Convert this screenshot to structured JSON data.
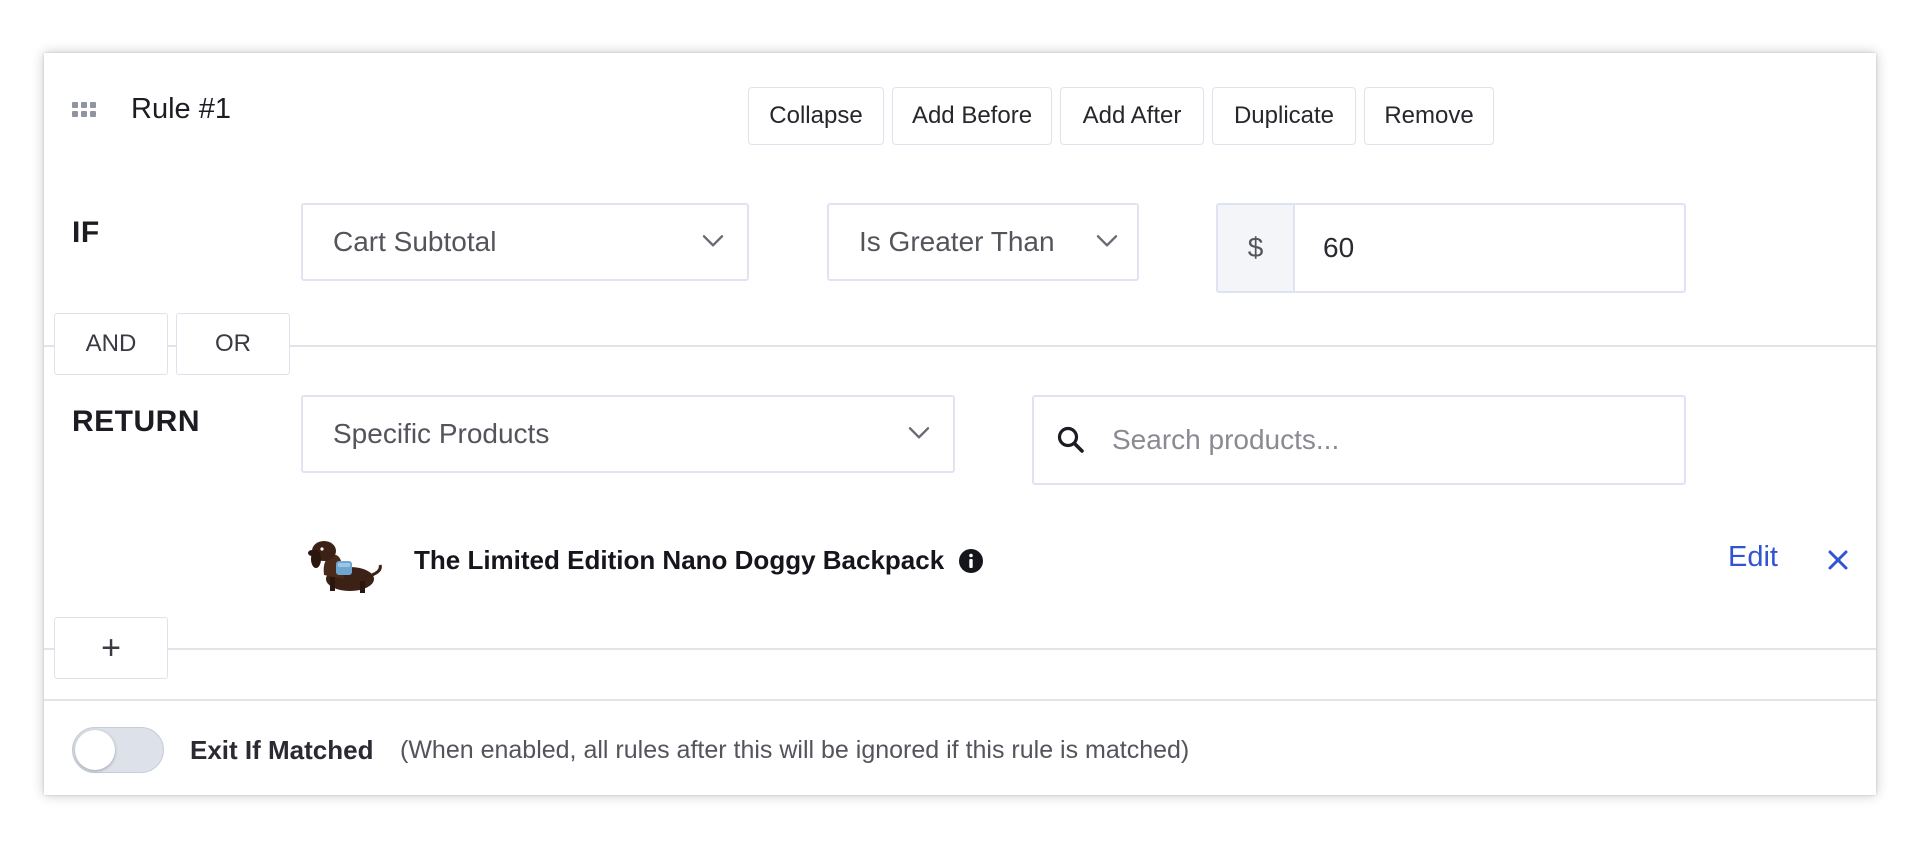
{
  "rule": {
    "title": "Rule #1"
  },
  "toolbar": {
    "collapse_label": "Collapse",
    "add_before_label": "Add Before",
    "add_after_label": "Add After",
    "duplicate_label": "Duplicate",
    "remove_label": "Remove"
  },
  "condition": {
    "label": "IF",
    "field_selected": "Cart Subtotal",
    "operator_selected": "Is Greater Than",
    "currency_prefix": "$",
    "value": "60"
  },
  "logic": {
    "and_label": "AND",
    "or_label": "OR"
  },
  "result": {
    "label": "RETURN",
    "type_selected": "Specific Products",
    "search_placeholder": "Search products...",
    "products": [
      {
        "name": "The Limited Edition Nano Doggy Backpack",
        "edit_label": "Edit"
      }
    ],
    "add_label": "+"
  },
  "footer": {
    "exit_toggle_on": false,
    "exit_label": "Exit If Matched",
    "exit_description": "(When enabled, all rules after this will be ignored if this rule is matched)"
  },
  "colors": {
    "link": "#2f55d4",
    "border": "#e1e3f2",
    "text": "#1c1c22",
    "toggle_off": "#dde2ea"
  },
  "icons": {
    "drag": "drag-handle-icon",
    "chevron": "chevron-down-icon",
    "search": "search-icon",
    "info": "info-icon",
    "close": "close-icon"
  }
}
